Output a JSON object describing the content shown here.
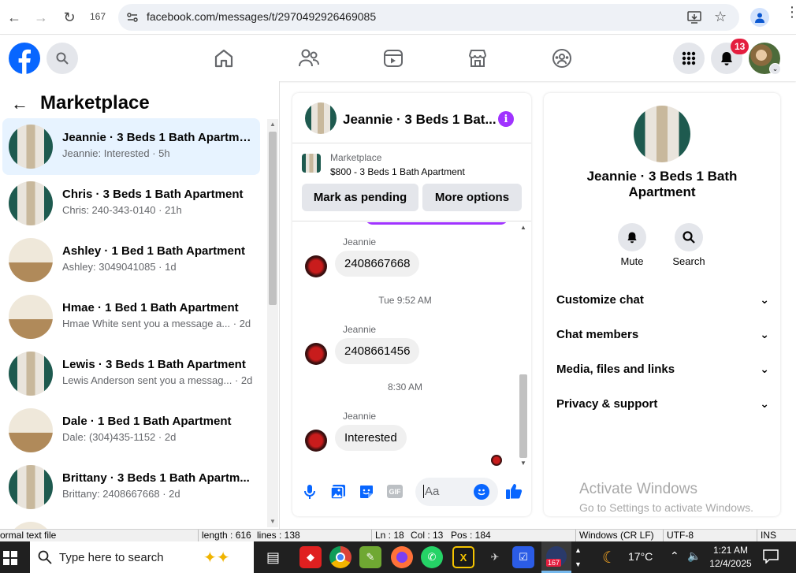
{
  "browser": {
    "tab_count": "167",
    "url": "facebook.com/messages/t/2970492926469085"
  },
  "header": {
    "notifications_count": "13"
  },
  "sidebar": {
    "title": "Marketplace",
    "conversations": [
      {
        "title": "Jeannie · 3 Beds 1 Bath Apartme...",
        "subtitle": "Jeannie: Interested · 5h"
      },
      {
        "title": "Chris · 3 Beds 1 Bath Apartment",
        "subtitle": "Chris: 240-343-0140 · 21h"
      },
      {
        "title": "Ashley · 1 Bed 1 Bath Apartment",
        "subtitle": "Ashley: 3049041085 · 1d"
      },
      {
        "title": "Hmae · 1 Bed 1 Bath Apartment",
        "subtitle": "Hmae White sent you a message a...  · 2d"
      },
      {
        "title": "Lewis · 3 Beds 1 Bath Apartment",
        "subtitle": "Lewis Anderson sent you a messag...  · 2d"
      },
      {
        "title": "Dale · 1 Bed 1 Bath Apartment",
        "subtitle": "Dale: (304)435-1152 · 2d"
      },
      {
        "title": "Brittany · 3 Beds 1 Bath Apartm...",
        "subtitle": "Brittany: 2408667668 · 2d"
      }
    ]
  },
  "chat": {
    "title": "Jeannie · 3 Beds 1 Bat...",
    "listing_source": "Marketplace",
    "listing_title": "$800 - 3 Beds 1 Bath Apartment",
    "mark_pending_label": "Mark as pending",
    "more_options_label": "More options",
    "messages": [
      {
        "sender": "Jeannie",
        "text": "2408667668"
      },
      {
        "sender": "Jeannie",
        "text": "2408661456"
      },
      {
        "sender": "Jeannie",
        "text": "Interested"
      }
    ],
    "timestamps": [
      "Tue 9:52 AM",
      "8:30 AM"
    ],
    "composer_placeholder": "Aa"
  },
  "details": {
    "name": "Jeannie · 3 Beds 1 Bath Apartment",
    "mute_label": "Mute",
    "search_label": "Search",
    "sections": [
      "Customize chat",
      "Chat members",
      "Media, files and links",
      "Privacy & support"
    ]
  },
  "watermark": {
    "line1": "Activate Windows",
    "line2": "Go to Settings to activate Windows."
  },
  "statusbar": {
    "mode": "ormal text file",
    "length": "length : 616",
    "lines": "lines : 138",
    "ln": "Ln : 18",
    "col": "Col : 13",
    "pos": "Pos : 184",
    "eol": "Windows (CR LF)",
    "encoding": "UTF-8",
    "ins": "INS"
  },
  "taskbar": {
    "search_placeholder": "Type here to search",
    "weather": "17°C",
    "time": "1:21 AM",
    "date": "12/4/2025",
    "browser_badge": "167"
  },
  "colors": {
    "fb_blue": "#0866ff",
    "active_row": "#e7f3ff",
    "messenger_purple": "#a033ff",
    "badge_red": "#e41e3f"
  }
}
